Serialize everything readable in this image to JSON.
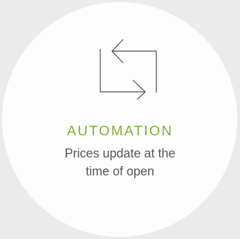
{
  "card": {
    "icon": "refresh-arrows-icon",
    "heading": "AUTOMATION",
    "description_line1": "Prices update at the",
    "description_line2": "time of open"
  },
  "colors": {
    "accent": "#7fb038",
    "text": "#555555",
    "icon_stroke": "#444444",
    "background": "#ebebeb",
    "circle": "#fdfdfd"
  }
}
